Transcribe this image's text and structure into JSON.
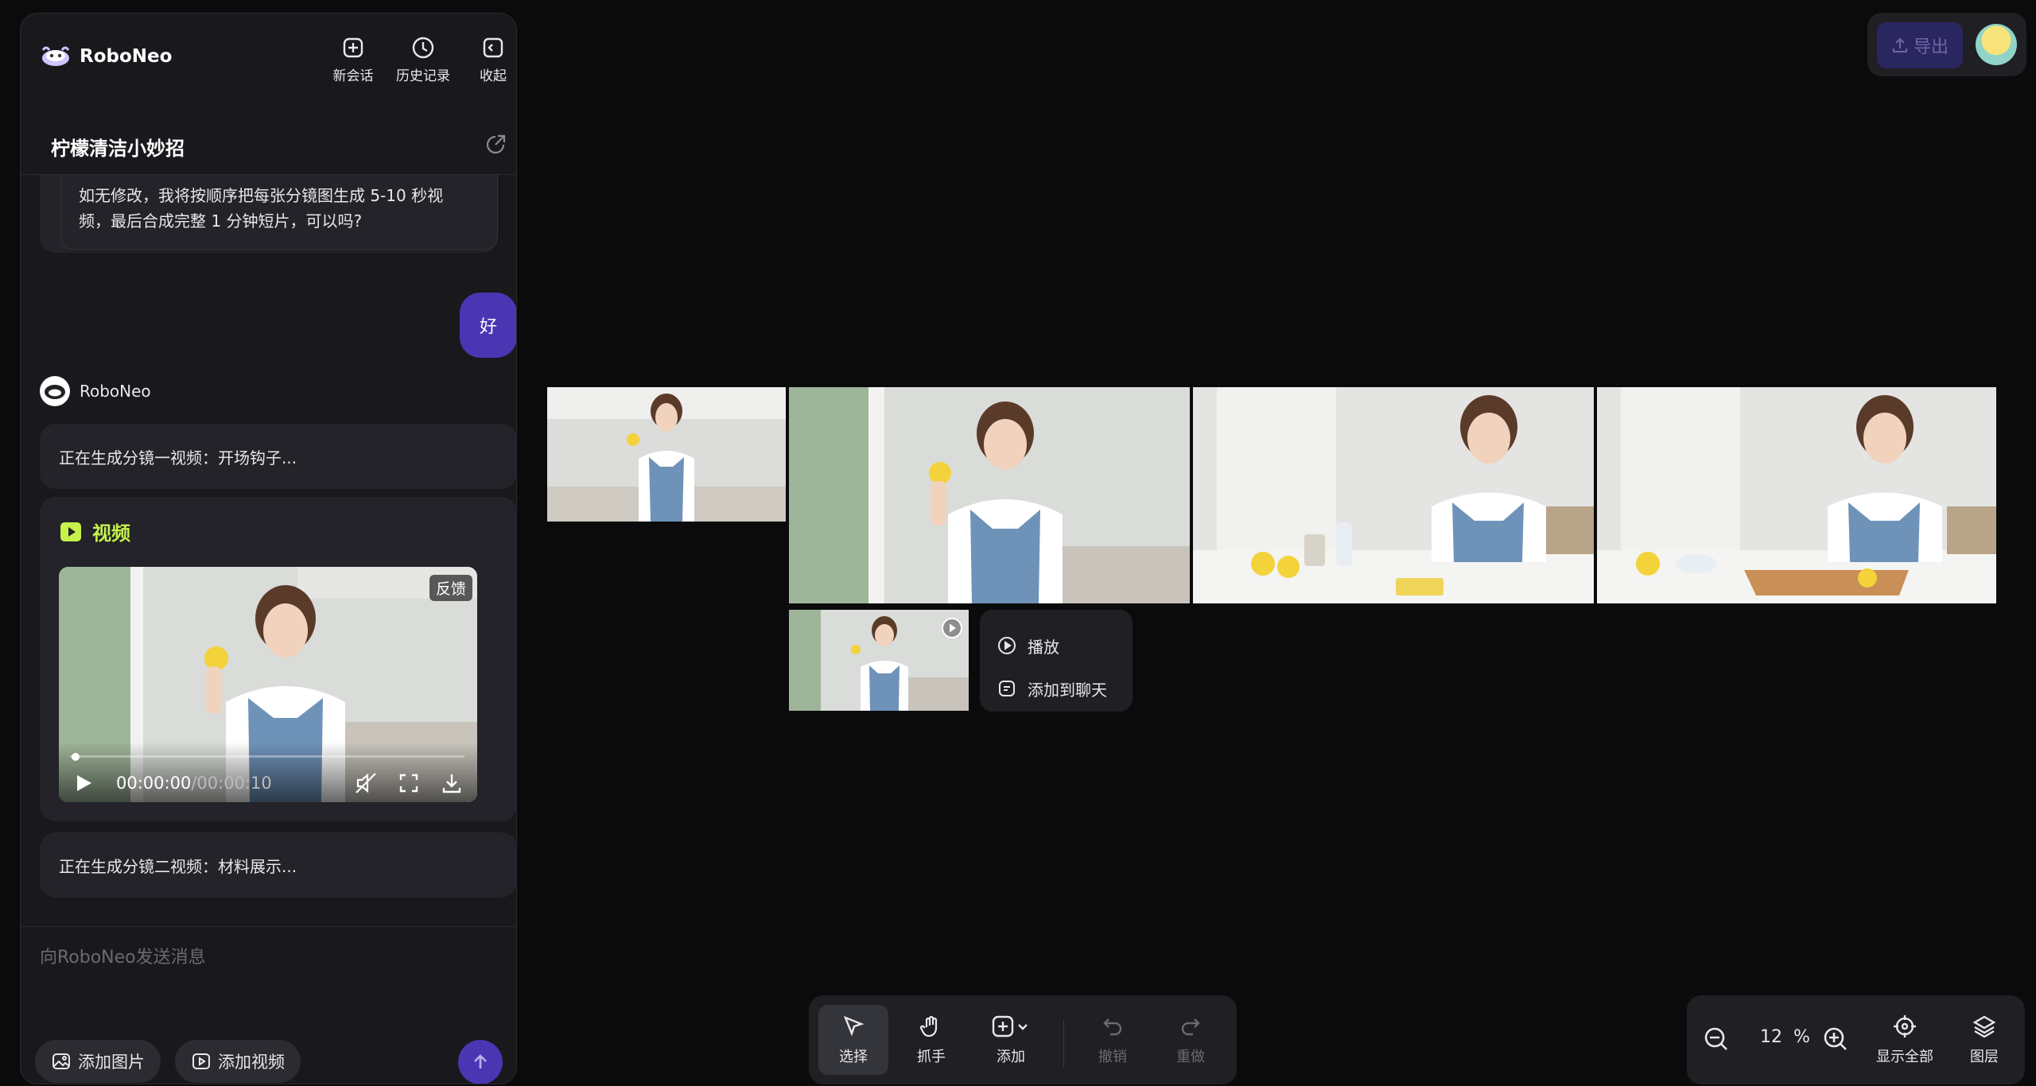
{
  "app": {
    "name": "RoboNeo"
  },
  "header": {
    "new_chat": "新会话",
    "history": "历史记录",
    "collapse": "收起"
  },
  "conversation": {
    "title": "柠檬清洁小妙招",
    "previous_message_line1": "如无修改，我将按顺序把每张分镜图生成 5-10 秒视",
    "previous_message_line2": "频，最后合成完整 1 分钟短片，可以吗?",
    "user_reply": "好",
    "bot_name": "RoboNeo",
    "status_1": "正在生成分镜一视频：开场钩子...",
    "video_section_label": "视频",
    "video_feedback": "反馈",
    "video_current_time": "00:00:00",
    "video_duration": "/00:00:10",
    "video_progress": 0.0,
    "status_2": "正在生成分镜二视频：材料展示..."
  },
  "composer": {
    "placeholder": "向RoboNeo发送消息",
    "add_image": "添加图片",
    "add_video": "添加视频"
  },
  "top_right": {
    "export": "导出"
  },
  "context_menu": {
    "play": "播放",
    "add_to_chat": "添加到聊天"
  },
  "toolbar": {
    "select": "选择",
    "hand": "抓手",
    "add": "添加",
    "undo": "撤销",
    "redo": "重做"
  },
  "zoom": {
    "value": "12",
    "unit": "%",
    "show_all": "显示全部",
    "layers": "图层"
  },
  "colors": {
    "accent": "#4a36b3",
    "video_label": "#c6f24a",
    "panel_bg": "#19191d",
    "canvas_bg": "#0b0b0c"
  }
}
